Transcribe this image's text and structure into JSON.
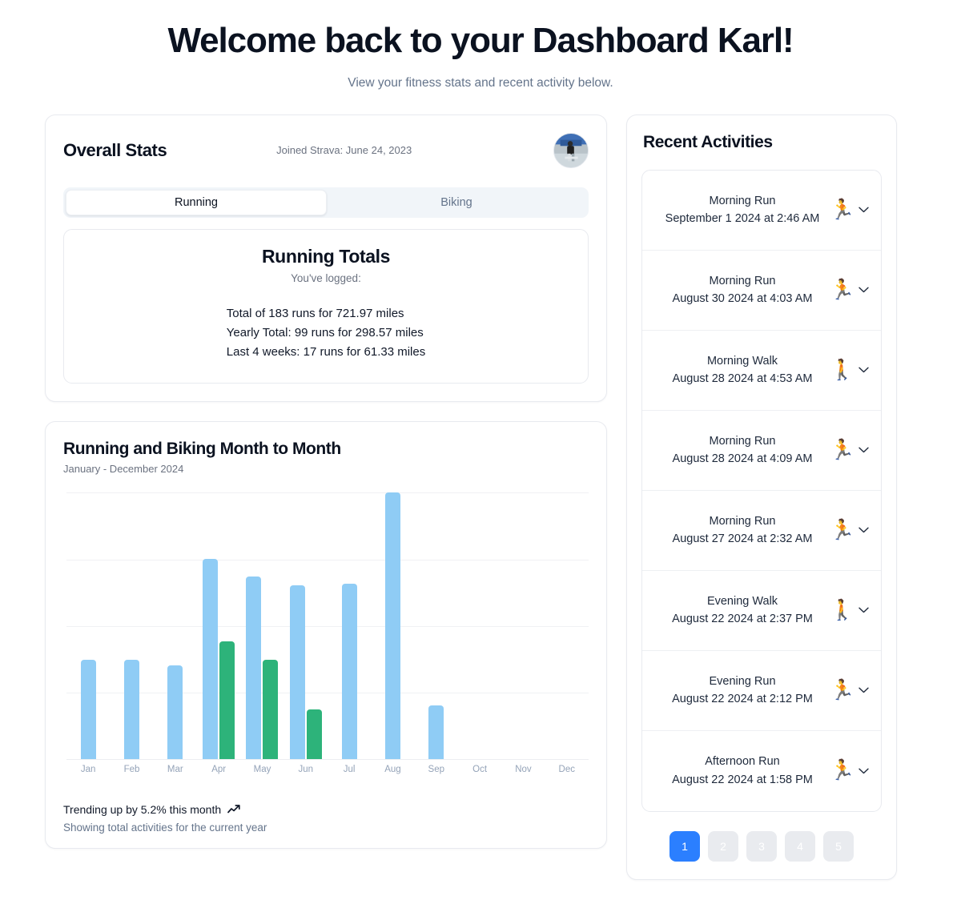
{
  "header": {
    "title": "Welcome back to your Dashboard Karl!",
    "subtitle": "View your fitness stats and recent activity below."
  },
  "overall_stats": {
    "title": "Overall Stats",
    "joined": "Joined Strava: June 24, 2023",
    "avatar_icon": "user-photo-avatar",
    "tabs": [
      {
        "label": "Running",
        "active": true
      },
      {
        "label": "Biking",
        "active": false
      }
    ],
    "totals": {
      "title": "Running Totals",
      "subtitle": "You've logged:",
      "lines": [
        "Total of 183 runs for 721.97 miles",
        "Yearly Total: 99 runs for 298.57 miles",
        "Last 4 weeks: 17 runs for 61.33 miles"
      ]
    }
  },
  "chart_card": {
    "title": "Running and Biking Month to Month",
    "subtitle": "January - December 2024",
    "trend": "Trending up by 5.2% this month",
    "trend_icon": "trending-up-icon",
    "note": "Showing total activities for the current year"
  },
  "chart_data": {
    "type": "bar",
    "title": "Running and Biking Month to Month",
    "subtitle": "January - December 2024",
    "xlabel": "",
    "ylabel": "",
    "grid": true,
    "legend": "none",
    "ylim": [
      0,
      20
    ],
    "gridlines": [
      0,
      5,
      10,
      15,
      20
    ],
    "categories": [
      "Jan",
      "Feb",
      "Mar",
      "Apr",
      "May",
      "Jun",
      "Jul",
      "Aug",
      "Sep",
      "Oct",
      "Nov",
      "Dec"
    ],
    "series": [
      {
        "name": "Running",
        "color": "#8fccf5",
        "values": [
          7.4,
          7.4,
          7.0,
          15.0,
          13.7,
          13.0,
          13.1,
          20.0,
          4.0,
          0,
          0,
          0
        ]
      },
      {
        "name": "Biking",
        "color": "#2db37a",
        "values": [
          0,
          0,
          0,
          8.8,
          7.4,
          3.7,
          0,
          0,
          0,
          0,
          0,
          0
        ]
      }
    ]
  },
  "recent_activities": {
    "title": "Recent Activities",
    "items": [
      {
        "name": "Morning Run",
        "date": "September 1 2024 at 2:46 AM",
        "icon": "🏃",
        "icon_name": "running-icon",
        "chevron": "chevron-down-icon"
      },
      {
        "name": "Morning Run",
        "date": "August 30 2024 at 4:03 AM",
        "icon": "🏃",
        "icon_name": "running-icon",
        "chevron": "chevron-down-icon"
      },
      {
        "name": "Morning Walk",
        "date": "August 28 2024 at 4:53 AM",
        "icon": "🚶",
        "icon_name": "walking-icon",
        "chevron": "chevron-down-icon"
      },
      {
        "name": "Morning Run",
        "date": "August 28 2024 at 4:09 AM",
        "icon": "🏃",
        "icon_name": "running-icon",
        "chevron": "chevron-down-icon"
      },
      {
        "name": "Morning Run",
        "date": "August 27 2024 at 2:32 AM",
        "icon": "🏃",
        "icon_name": "running-icon",
        "chevron": "chevron-down-icon"
      },
      {
        "name": "Evening Walk",
        "date": "August 22 2024 at 2:37 PM",
        "icon": "🚶",
        "icon_name": "walking-icon",
        "chevron": "chevron-down-icon"
      },
      {
        "name": "Evening Run",
        "date": "August 22 2024 at 2:12 PM",
        "icon": "🏃",
        "icon_name": "running-icon",
        "chevron": "chevron-down-icon"
      },
      {
        "name": "Afternoon Run",
        "date": "August 22 2024 at 1:58 PM",
        "icon": "🏃",
        "icon_name": "running-icon",
        "chevron": "chevron-down-icon"
      }
    ],
    "pagination": {
      "pages": [
        "1",
        "2",
        "3",
        "4",
        "5"
      ],
      "active": "1"
    }
  },
  "colors": {
    "running_bar": "#8fccf5",
    "biking_bar": "#2db37a",
    "accent": "#2b7fff",
    "text": "#0b1220",
    "muted": "#64748b"
  }
}
